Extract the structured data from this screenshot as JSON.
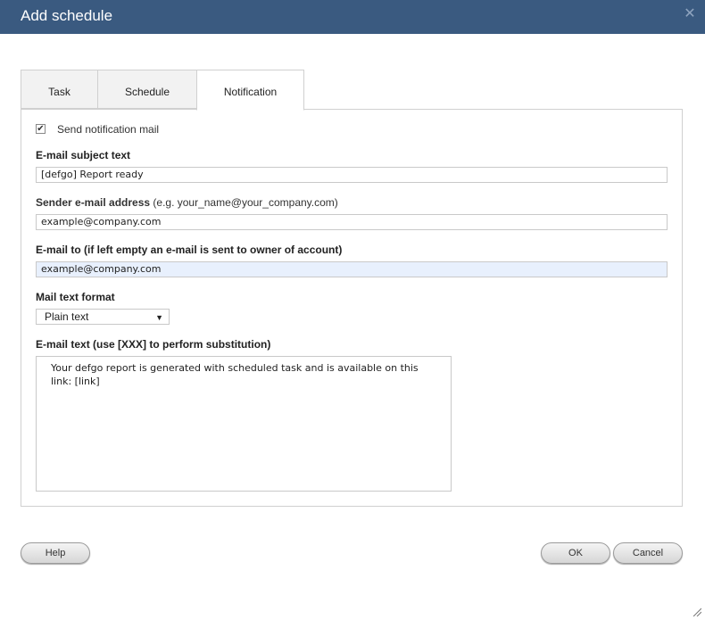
{
  "dialog": {
    "title": "Add schedule",
    "close_icon": "close-icon"
  },
  "tabs": [
    {
      "label": "Task",
      "active": false
    },
    {
      "label": "Schedule",
      "active": false
    },
    {
      "label": "Notification",
      "active": true
    }
  ],
  "form": {
    "send_notification": {
      "label": "Send notification mail",
      "checked": true
    },
    "subject": {
      "label": "E-mail subject text",
      "value": "[defgo] Report ready"
    },
    "sender": {
      "label_bold": "Sender e-mail address",
      "label_hint": " (e.g. your_name@your_company.com)",
      "value": "example@company.com"
    },
    "mail_to": {
      "label": "E-mail to (if left empty an e-mail is sent to owner of account)",
      "value": "example@company.com"
    },
    "format": {
      "label": "Mail text format",
      "selected": "Plain text"
    },
    "mail_text": {
      "label": "E-mail text (use [XXX] to perform substitution)",
      "value": "Your defgo report is generated with scheduled task and is available on this link: [link]"
    }
  },
  "buttons": {
    "help": "Help",
    "ok": "OK",
    "cancel": "Cancel"
  },
  "colors": {
    "titlebar": "#3a5a80",
    "highlight_input": "#e8f0fd"
  }
}
